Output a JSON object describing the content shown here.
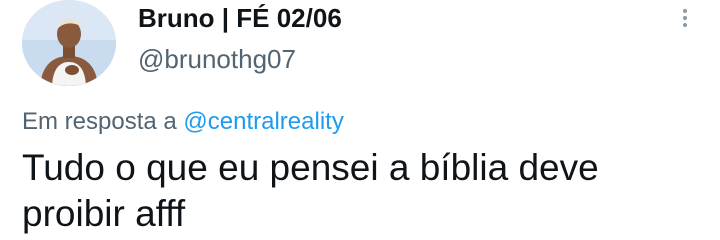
{
  "author": {
    "display_name": "Bruno | FÉ 02/06",
    "handle": "@brunothg07"
  },
  "reply": {
    "prefix": "Em resposta a",
    "mention": "@centralreality"
  },
  "tweet": {
    "text": "Tudo o que eu pensei a bíblia deve proibir afff"
  },
  "icons": {
    "more": "more-options-icon",
    "avatar": "profile-photo"
  },
  "colors": {
    "text": "#0f1419",
    "secondary": "#536471",
    "link": "#1d9bf0"
  }
}
